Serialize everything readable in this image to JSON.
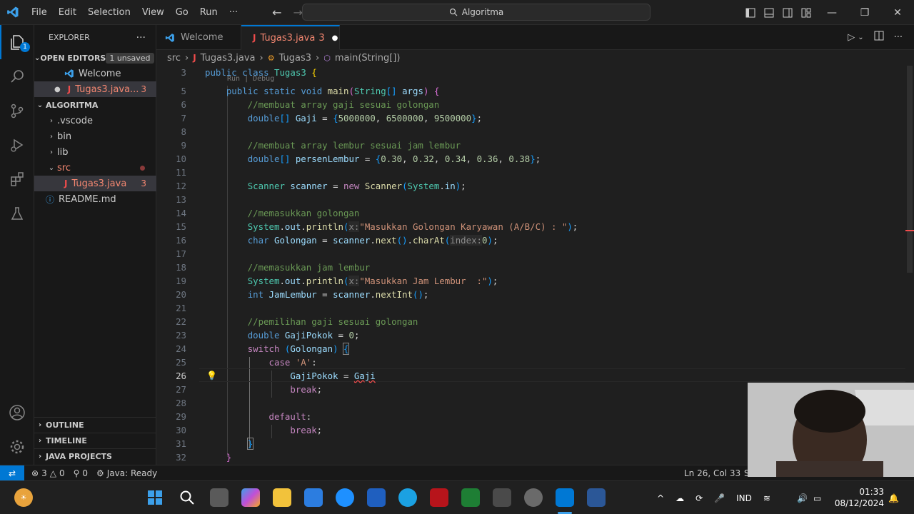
{
  "titlebar": {
    "menu": [
      "File",
      "Edit",
      "Selection",
      "View",
      "Go",
      "Run",
      "···"
    ],
    "search": "Algoritma"
  },
  "activity": {
    "explorer_badge": "1"
  },
  "sidebar": {
    "title": "EXPLORER",
    "open_editors": {
      "label": "OPEN EDITORS",
      "pill": "1 unsaved",
      "items": [
        {
          "name": "Welcome"
        },
        {
          "name": "Tugas3.java...",
          "problems": "3"
        }
      ]
    },
    "project": {
      "label": "ALGORITMA",
      "items": [
        {
          "name": ".vscode"
        },
        {
          "name": "bin"
        },
        {
          "name": "lib"
        },
        {
          "name": "src"
        },
        {
          "name": "Tugas3.java",
          "problems": "3"
        },
        {
          "name": "README.md"
        }
      ]
    },
    "outline": "OUTLINE",
    "timeline": "TIMELINE",
    "java_projects": "JAVA PROJECTS"
  },
  "tabs": [
    {
      "label": "Welcome"
    },
    {
      "label": "Tugas3.java",
      "problems": "3"
    }
  ],
  "breadcrumb": {
    "folder": "src",
    "file": "Tugas3.java",
    "class": "Tugas3",
    "method": "main(String[])"
  },
  "editor": {
    "line_numbers": [
      "3",
      "5",
      "6",
      "7",
      "8",
      "9",
      "10",
      "11",
      "12",
      "13",
      "14",
      "15",
      "16",
      "17",
      "18",
      "19",
      "20",
      "21",
      "22",
      "23",
      "24",
      "25",
      "26",
      "27",
      "28",
      "29",
      "30",
      "31",
      "32"
    ],
    "codelens": "Run | Debug",
    "current_line": "26"
  },
  "statusbar": {
    "errors": "3",
    "warnings": "0",
    "ports": "0",
    "java": "Java: Ready",
    "position": "Ln 26, Col 33",
    "cut": "S"
  },
  "taskbar": {
    "lang": "IND",
    "time": "01:33",
    "date": "08/12/2024"
  },
  "colors": {
    "accent": "#0078d4",
    "editor_bg": "#1f1f1f",
    "sidebar_bg": "#181818"
  }
}
